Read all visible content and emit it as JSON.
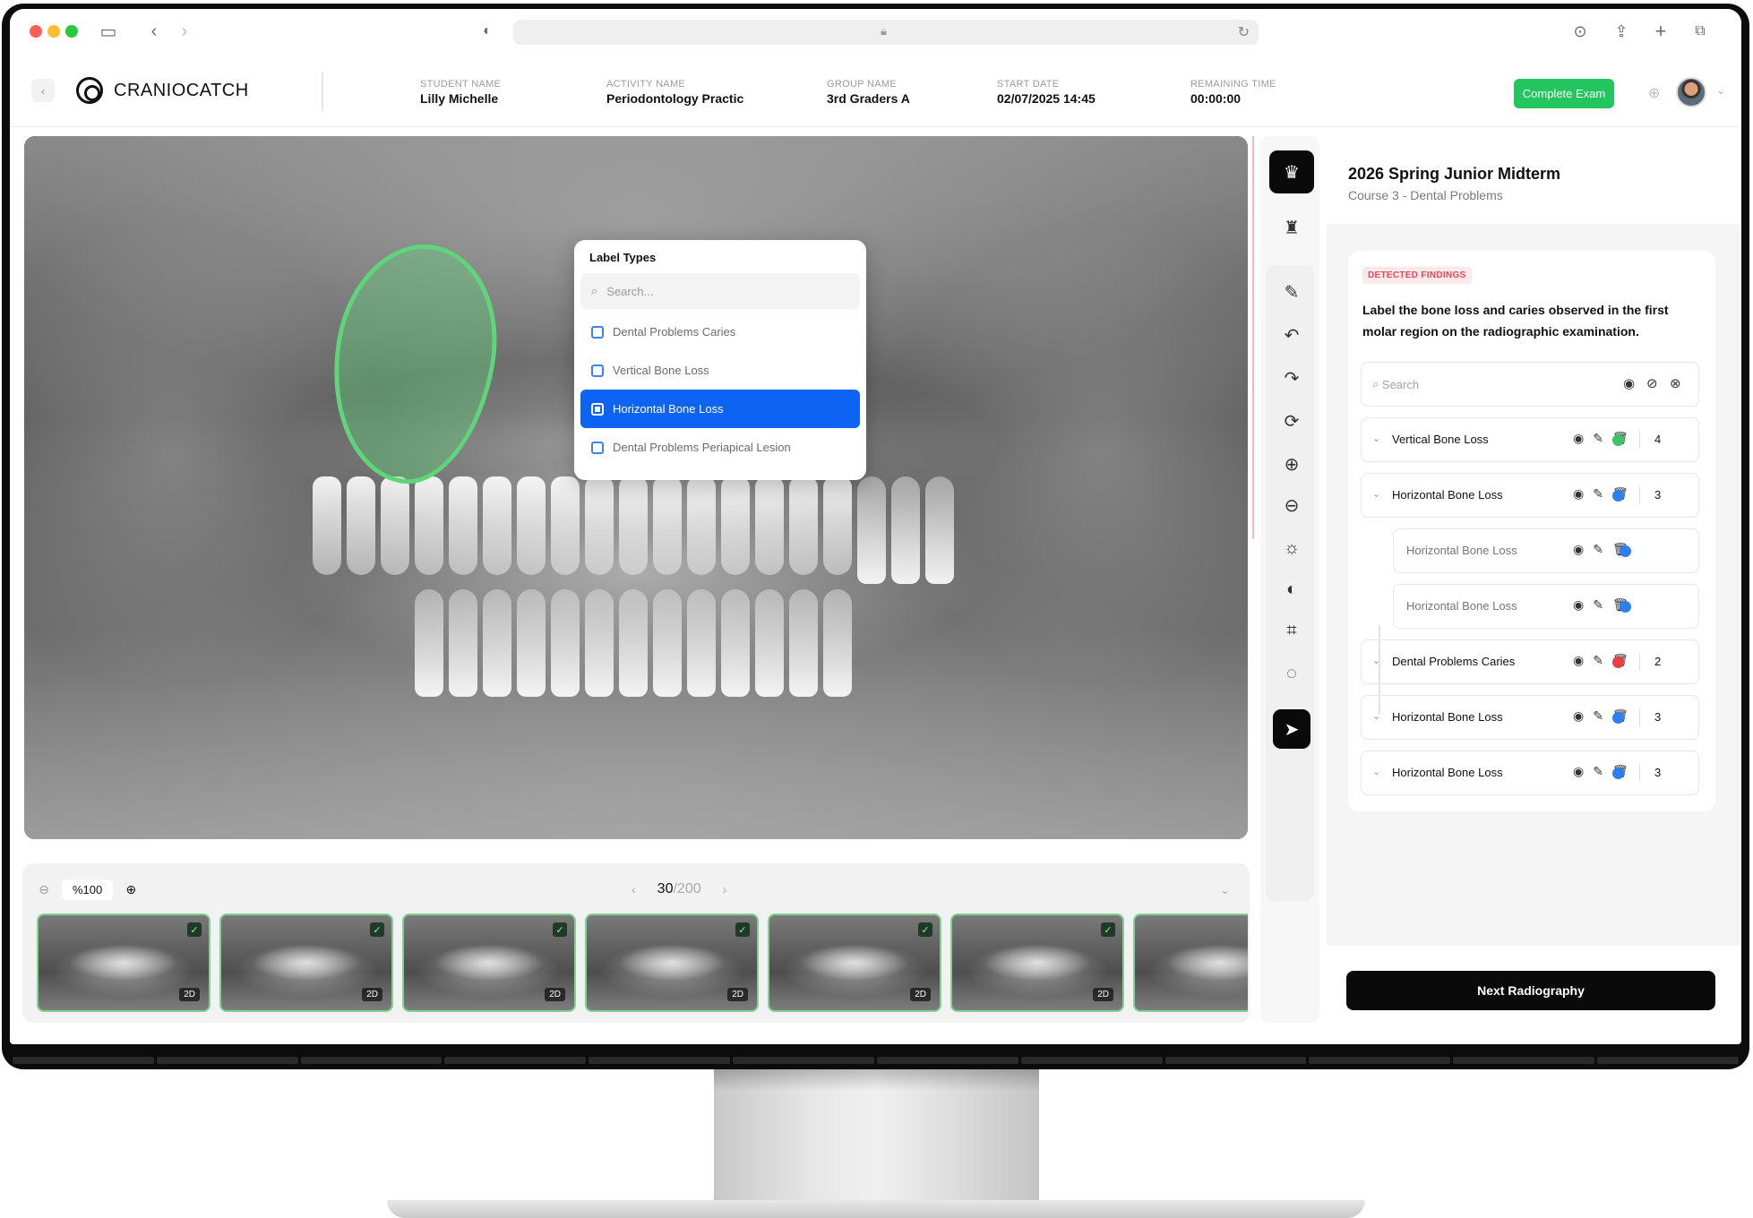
{
  "header": {
    "brand": "CRANIOCATCH",
    "complete_button": "Complete Exam",
    "meta": [
      {
        "key": "STUDENT NAME",
        "value": "Lilly Michelle"
      },
      {
        "key": "ACTIVITY NAME",
        "value": "Periodontology Practic"
      },
      {
        "key": "GROUP NAME",
        "value": "3rd Graders A"
      },
      {
        "key": "START DATE",
        "value": "02/07/2025 14:45"
      },
      {
        "key": "REMAINING TIME",
        "value": "00:00:00"
      }
    ]
  },
  "dropdown": {
    "title": "Label Types",
    "search_placeholder": "Search...",
    "options": [
      {
        "label": "Dental Problems Caries",
        "selected": false
      },
      {
        "label": "Vertical Bone Loss",
        "selected": false
      },
      {
        "label": "Horizontal Bone Loss",
        "selected": true
      },
      {
        "label": "Dental Problems Periapical Lesion",
        "selected": false
      }
    ]
  },
  "strip": {
    "zoom": "%100",
    "page_current": "30",
    "page_total": "/200",
    "thumb_badge": "2D",
    "thumb_count": 7
  },
  "panel": {
    "title": "2026 Spring Junior Midterm",
    "subtitle": "Course 3 - Dental Problems",
    "tag": "DETECTED FINDINGS",
    "prompt": "Label the bone loss and caries observed in the first molar region on the radiographic examination.",
    "search_placeholder": "Search",
    "findings": [
      {
        "label": "Vertical Bone Loss",
        "count": "4",
        "color": "#3cc466",
        "child": false
      },
      {
        "label": "Horizontal Bone Loss",
        "count": "3",
        "color": "#2d7ff0",
        "child": false
      },
      {
        "label": "Horizontal Bone Loss",
        "count": "",
        "color": "#2d7ff0",
        "child": true
      },
      {
        "label": "Horizontal Bone Loss",
        "count": "",
        "color": "#2d7ff0",
        "child": true
      },
      {
        "label": "Dental Problems Caries",
        "count": "2",
        "color": "#e84040",
        "child": false
      },
      {
        "label": "Horizontal Bone Loss",
        "count": "3",
        "color": "#2d7ff0",
        "child": false
      },
      {
        "label": "Horizontal Bone Loss",
        "count": "3",
        "color": "#2d7ff0",
        "child": false
      }
    ],
    "next_button": "Next Radiography"
  },
  "colors": {
    "accent_green": "#22c55e",
    "select_blue": "#0d63f3",
    "lesion_green": "#5fd47a"
  }
}
